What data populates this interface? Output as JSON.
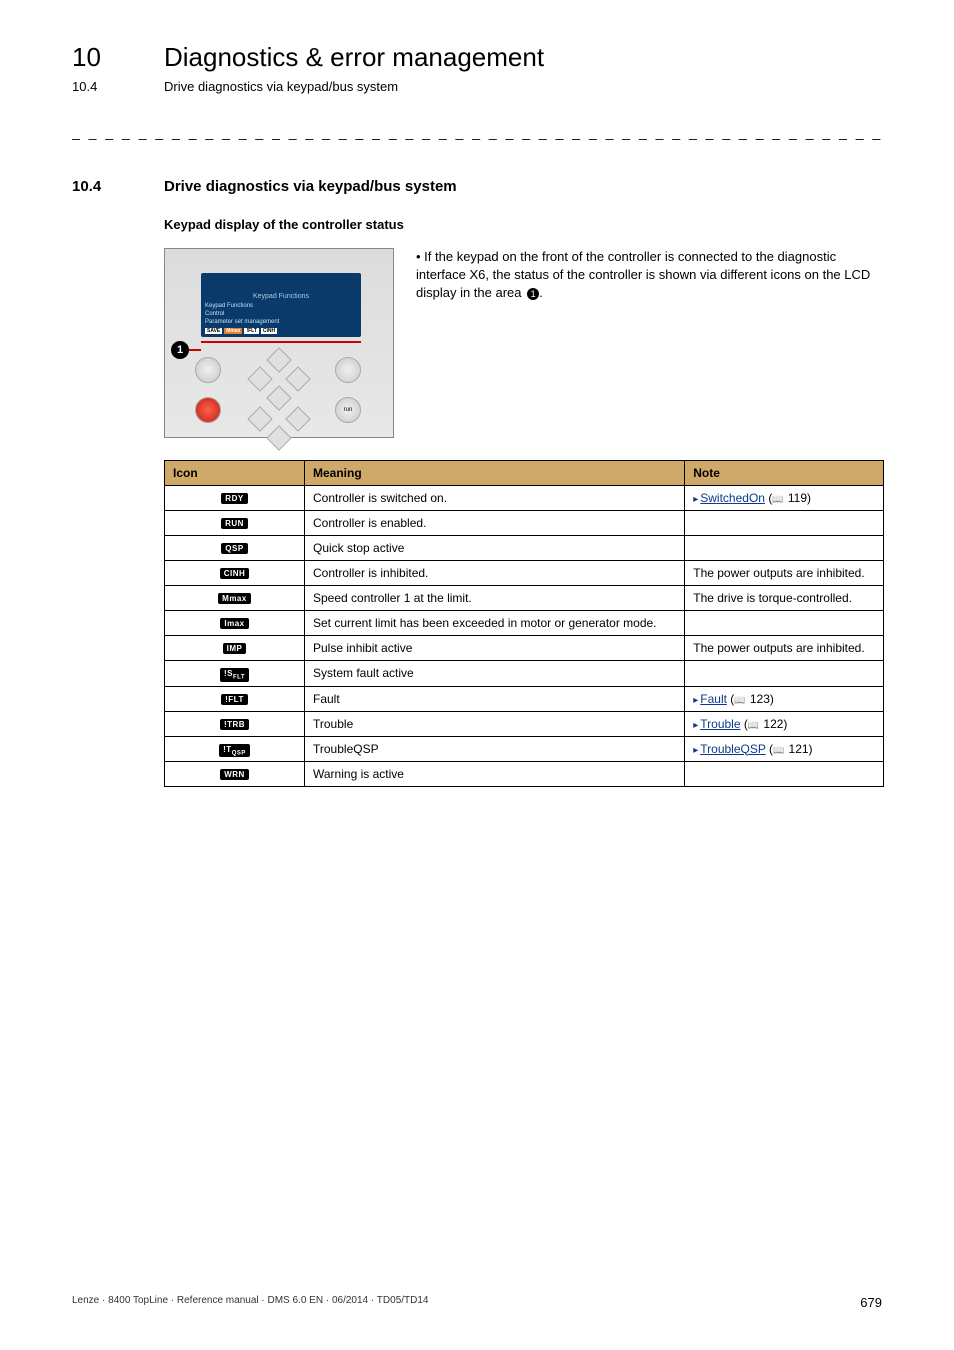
{
  "header": {
    "chapter_num": "10",
    "chapter_title": "Diagnostics & error management",
    "subchapter_num": "10.4",
    "subchapter_title": "Drive diagnostics via keypad/bus system"
  },
  "section": {
    "num": "10.4",
    "title": "Drive diagnostics via keypad/bus system",
    "subhead": "Keypad display of the controller status"
  },
  "keypad_image": {
    "lcd_title": "Keypad Functions",
    "lcd_lines": [
      "Keypad Functions",
      "Control",
      "Parameter set management"
    ],
    "lcd_badges": [
      "SAVE",
      "Mmax",
      "!FLT",
      "CINH"
    ],
    "callout_num": "1"
  },
  "bullet_text": "If the keypad on the front of the controller is connected to the diagnostic interface X6, the status of the controller is shown via different icons on the LCD display in the area ",
  "table": {
    "headers": [
      "Icon",
      "Meaning",
      "Note"
    ],
    "rows": [
      {
        "icon": "RDY",
        "icon_style": "black",
        "meaning": "Controller is switched on.",
        "note_link": "SwitchedOn",
        "note_page": "119"
      },
      {
        "icon": "RUN",
        "icon_style": "black",
        "meaning": "Controller is enabled.",
        "note": ""
      },
      {
        "icon": "QSP",
        "icon_style": "black",
        "meaning": "Quick stop active",
        "note": ""
      },
      {
        "icon": "CINH",
        "icon_style": "black",
        "meaning": "Controller is inhibited.",
        "note": "The power outputs are inhibited."
      },
      {
        "icon": "Mmax",
        "icon_style": "black",
        "meaning": "Speed controller 1 at the limit.",
        "note": "The drive is torque-controlled."
      },
      {
        "icon": "Imax",
        "icon_style": "black",
        "meaning": "Set current limit has been exceeded in motor or generator mode.",
        "note": ""
      },
      {
        "icon": "IMP",
        "icon_style": "black",
        "meaning": "Pulse inhibit active",
        "note": "The power outputs are inhibited."
      },
      {
        "icon": "!SFLT",
        "icon_sub": "FLT",
        "icon_prefix": "!S",
        "icon_style": "black",
        "meaning": "System fault active",
        "note": ""
      },
      {
        "icon": "!FLT",
        "icon_style": "black",
        "meaning": "Fault",
        "note_link": "Fault",
        "note_page": "123"
      },
      {
        "icon": "!TRB",
        "icon_style": "black",
        "meaning": "Trouble",
        "note_link": "Trouble",
        "note_page": "122"
      },
      {
        "icon": "!TQSP",
        "icon_sub": "QSP",
        "icon_prefix": "!T",
        "icon_style": "black",
        "meaning": "TroubleQSP",
        "note_link": "TroubleQSP",
        "note_page": "121"
      },
      {
        "icon": "WRN",
        "icon_style": "black",
        "meaning": "Warning is active",
        "note": ""
      }
    ]
  },
  "footer": {
    "left": "Lenze · 8400 TopLine · Reference manual · DMS 6.0 EN · 06/2014 · TD05/TD14",
    "page": "679"
  }
}
